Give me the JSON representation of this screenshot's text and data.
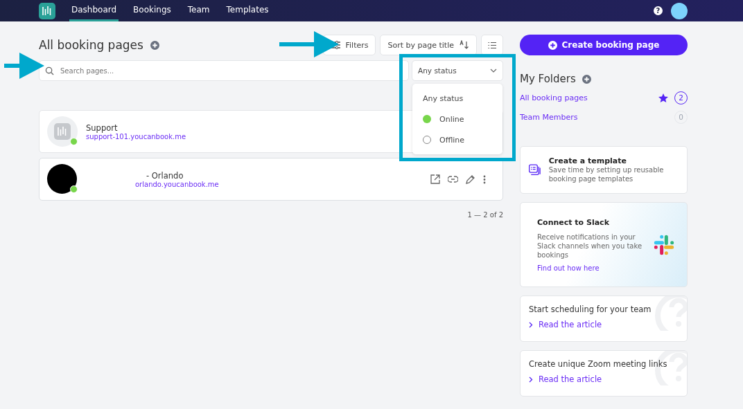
{
  "nav": {
    "items": [
      {
        "label": "Dashboard",
        "selected": true
      },
      {
        "label": "Bookings",
        "selected": false
      },
      {
        "label": "Team",
        "selected": false
      },
      {
        "label": "Templates",
        "selected": false
      }
    ],
    "help": "?"
  },
  "header": {
    "title": "All booking pages",
    "filters_button": "Filters",
    "sort_button": "Sort by page title"
  },
  "search": {
    "placeholder": "Search pages..."
  },
  "status_filter": {
    "value": "Any status",
    "expanded": true,
    "options": [
      {
        "label": "Any status",
        "kind": "any"
      },
      {
        "label": "Online",
        "kind": "online"
      },
      {
        "label": "Offline",
        "kind": "offline"
      }
    ]
  },
  "pages": [
    {
      "name": "Support",
      "url": "support-101.youcanbook.me",
      "online": true,
      "kind": "logo",
      "hovered": false
    },
    {
      "name": "- Orlando",
      "url": "orlando.youcanbook.me",
      "online": true,
      "kind": "dark",
      "hovered": true
    }
  ],
  "pagination": "1 — 2 of 2",
  "create_button": "Create booking page",
  "folders": {
    "title": "My Folders",
    "items": [
      {
        "label": "All booking pages",
        "count": "2",
        "starred": true,
        "selected": true
      },
      {
        "label": "Team Members",
        "count": "0",
        "starred": false,
        "selected": false
      }
    ]
  },
  "cards": [
    {
      "kind": "template",
      "title": "Create a template",
      "text": "Save time by setting up reusable booking page templates"
    },
    {
      "kind": "slack",
      "title": "Connect to Slack",
      "text": "Receive notifications in your Slack channels when you take bookings",
      "link": "Find out how here"
    },
    {
      "kind": "article",
      "title": "Start scheduling for your team",
      "link": "Read the article"
    },
    {
      "kind": "article",
      "title": "Create unique Zoom meeting links",
      "link": "Read the article"
    }
  ]
}
